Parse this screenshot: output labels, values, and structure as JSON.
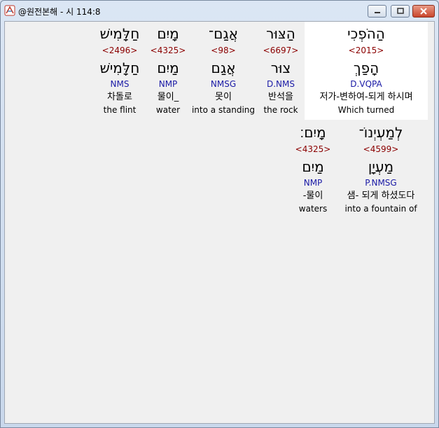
{
  "window": {
    "title": "@원전본해 - 시 114:8"
  },
  "icons": {
    "app": "app-icon",
    "minimize": "minimize-icon",
    "maximize": "maximize-icon",
    "close": "close-icon"
  },
  "words": [
    {
      "surface": "הַהֹפְכִי",
      "strong": "<2015>",
      "lemma": "הָפַךְ",
      "morph": "D.VQPA",
      "korean": "저가-변하여-되게 하시며",
      "english": "Which turned"
    },
    {
      "surface": "הַצּוּר",
      "strong": "<6697>",
      "lemma": "צוּר",
      "morph": "D.NMS",
      "korean": "반석을",
      "english": "the rock"
    },
    {
      "surface": "אֲגַם־",
      "strong": "<98>",
      "lemma": "אֲגַם",
      "morph": "NMSG",
      "korean": "못이",
      "english": "into a standing"
    },
    {
      "surface": "מָיִם",
      "strong": "<4325>",
      "lemma": "מַיִם",
      "morph": "NMP",
      "korean": "물이_",
      "english": "water"
    },
    {
      "surface": "חַלָּמִישׁ",
      "strong": "<2496>",
      "lemma": "חַלָּמִישׁ",
      "morph": "NMS",
      "korean": "차돌로",
      "english": "the flint"
    },
    {
      "surface": "לְמַעְיְנוֹ־",
      "strong": "<4599>",
      "lemma": "מַעְיָן",
      "morph": "P.NMSG",
      "korean": "샘- 되게 하셨도다",
      "english": "into a fountain of"
    },
    {
      "surface": "מָיִם׃",
      "strong": "<4325>",
      "lemma": "מַיִם",
      "morph": "NMP",
      "korean": "-물이",
      "english": "waters"
    }
  ]
}
